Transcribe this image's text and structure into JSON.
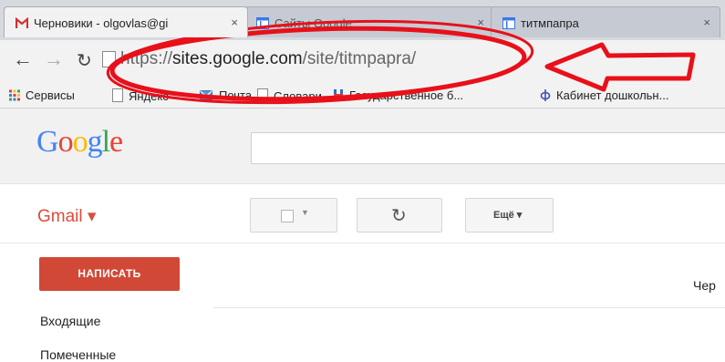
{
  "browser": {
    "tabs": [
      {
        "title": "Черновики - olgovlas@gi",
        "close": "×"
      },
      {
        "title": "Сайты Google",
        "close": "×"
      },
      {
        "title": "титмпапра",
        "close": "×"
      }
    ],
    "address": {
      "scheme": "https://",
      "host": "sites.google.com",
      "path": "/site/titmpapra/"
    },
    "bookmarks": [
      "Сервисы",
      "Яндекс",
      "Почта",
      "Словари",
      "Государственное б...",
      "Кабинет дошкольн..."
    ]
  },
  "gmail": {
    "logo": "Google",
    "label": "Gmail ▾",
    "more_button": "Ещё ▾",
    "compose": "НАПИСАТЬ",
    "folders": [
      "Входящие",
      "Помеченные"
    ],
    "drafts_label": "Чер"
  },
  "colors": {
    "annotation_red": "#e8101a",
    "compose_red": "#d14836",
    "gmail_red": "#dd4b39"
  }
}
